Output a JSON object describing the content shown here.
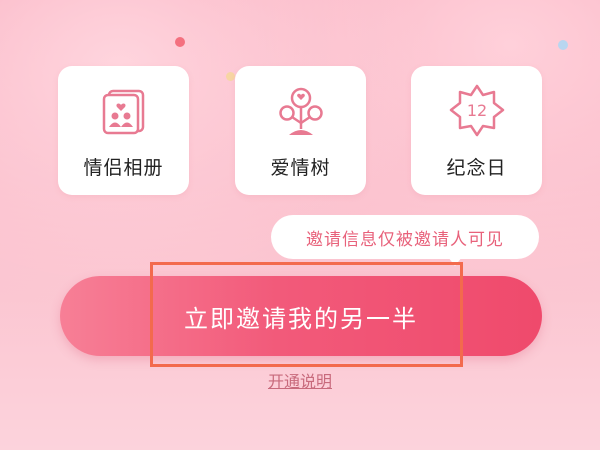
{
  "features": {
    "album": {
      "label": "情侣相册",
      "icon": "couple-album-icon"
    },
    "tree": {
      "label": "爱情树",
      "icon": "love-tree-icon"
    },
    "anniversary": {
      "label": "纪念日",
      "icon": "anniversary-badge-icon",
      "badge_number": "12"
    }
  },
  "tooltip": {
    "text": "邀请信息仅被邀请人可见"
  },
  "invite": {
    "button_label": "立即邀请我的另一半"
  },
  "link": {
    "label": "开通说明"
  },
  "colors": {
    "accent": "#ef4a6c",
    "icon_pink": "#e87a92",
    "tooltip_text": "#e8627b",
    "highlight_box": "#f36a4d"
  }
}
